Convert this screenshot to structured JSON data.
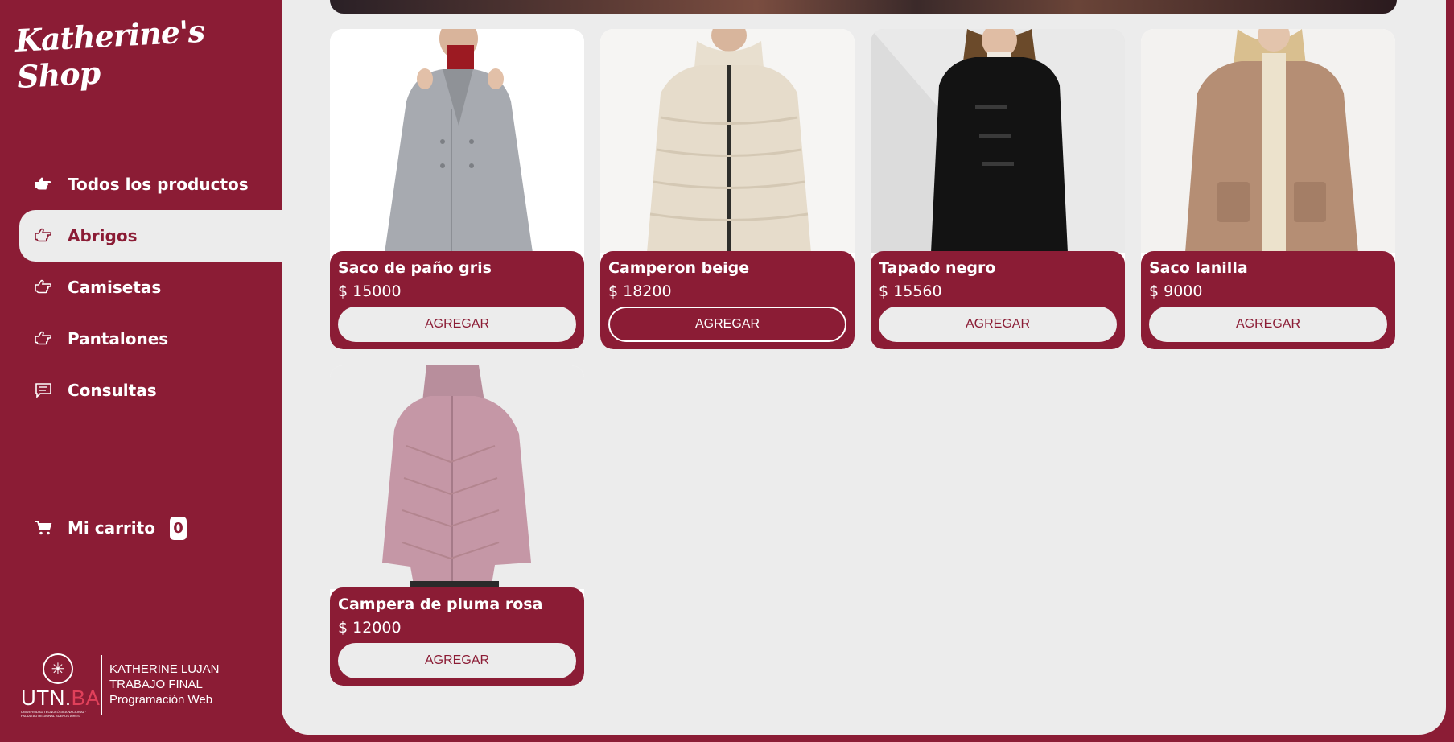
{
  "brand": {
    "logo_text": "Katherine's Shop"
  },
  "colors": {
    "primary": "#8b1c35",
    "background": "#ececec",
    "white": "#ffffff"
  },
  "sidebar": {
    "items": [
      {
        "label": "Todos los productos",
        "icon": "hand-pointing-right-filled-icon",
        "active": false
      },
      {
        "label": "Abrigos",
        "icon": "hand-pointing-right-outline-icon",
        "active": true
      },
      {
        "label": "Camisetas",
        "icon": "hand-pointing-right-outline-icon",
        "active": false
      },
      {
        "label": "Pantalones",
        "icon": "hand-pointing-right-outline-icon",
        "active": false
      },
      {
        "label": "Consultas",
        "icon": "chat-message-icon",
        "active": false
      }
    ],
    "cart": {
      "label": "Mi carrito",
      "count": "0",
      "icon": "shopping-cart-icon"
    }
  },
  "footer": {
    "utn_logo": {
      "utn": "UTN.",
      "ba": "BA",
      "small": "UNIVERSIDAD TECNOLÓGICA NACIONAL · FACULTAD REGIONAL BUENOS AIRES"
    },
    "lines": [
      "KATHERINE LUJAN",
      "TRABAJO FINAL",
      "Programación Web"
    ]
  },
  "products": [
    {
      "name": "Saco de paño gris",
      "price": "$ 15000",
      "button": "AGREGAR",
      "image": "gray-coat-photo"
    },
    {
      "name": "Camperon beige",
      "price": "$ 18200",
      "button": "AGREGAR",
      "image": "beige-puffer-photo"
    },
    {
      "name": "Tapado negro",
      "price": "$ 15560",
      "button": "AGREGAR",
      "image": "black-coat-photo"
    },
    {
      "name": "Saco lanilla",
      "price": "$ 9000",
      "button": "AGREGAR",
      "image": "tan-wool-coat-photo"
    },
    {
      "name": "Campera de pluma rosa",
      "price": "$ 12000",
      "button": "AGREGAR",
      "image": "pink-down-jacket-photo"
    }
  ]
}
